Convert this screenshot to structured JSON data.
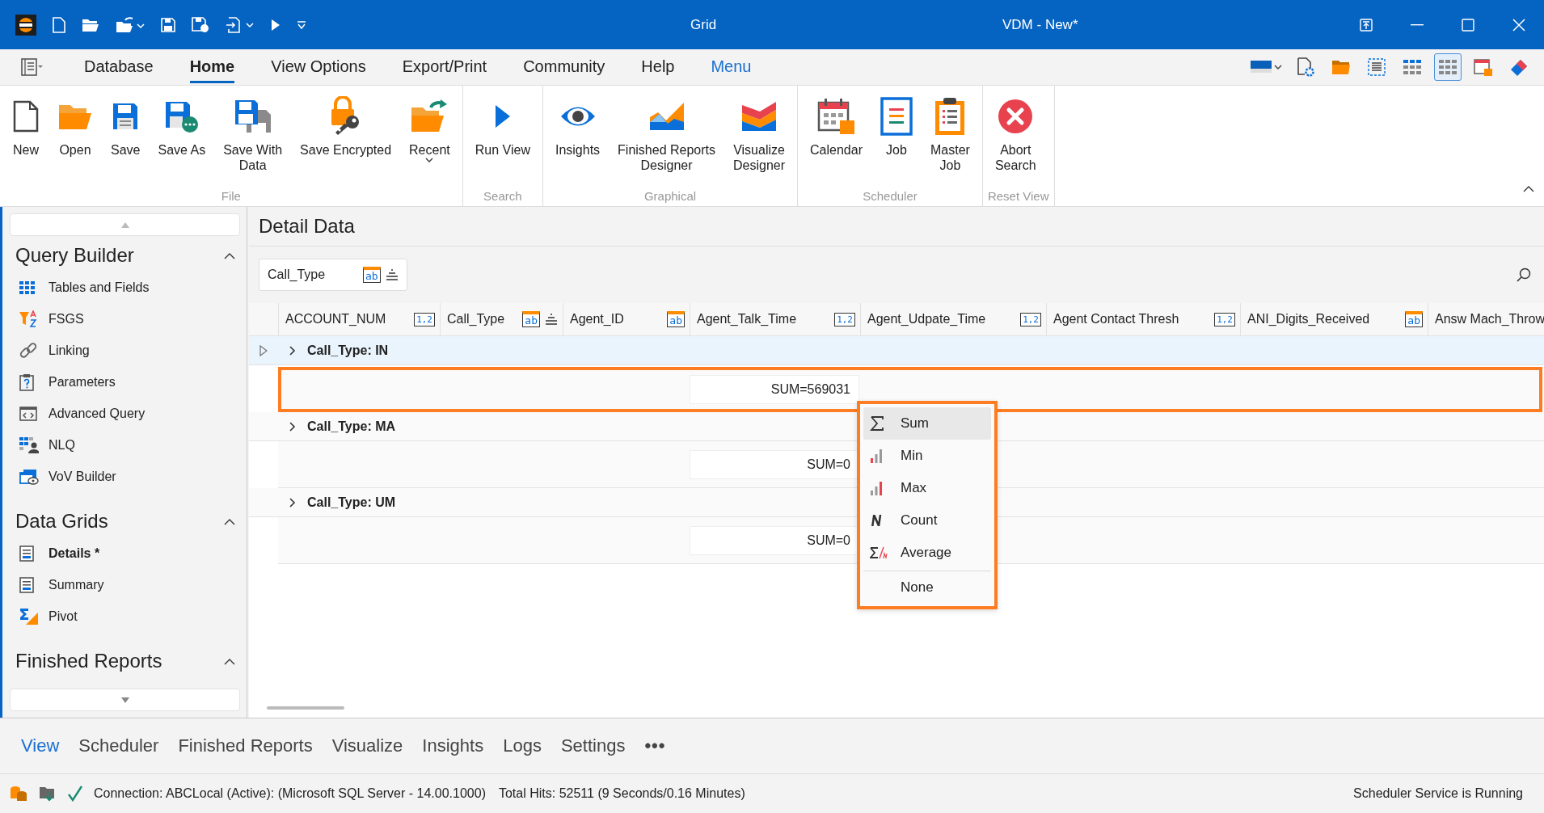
{
  "title_bar": {
    "app_name": "Grid",
    "title": "VDM - New*"
  },
  "menu_tabs": [
    {
      "label": "Database",
      "selected": false,
      "kind": "tab"
    },
    {
      "label": "Home",
      "selected": true,
      "kind": "tab"
    },
    {
      "label": "View Options",
      "selected": false,
      "kind": "tab"
    },
    {
      "label": "Export/Print",
      "selected": false,
      "kind": "tab"
    },
    {
      "label": "Community",
      "selected": false,
      "kind": "tab"
    },
    {
      "label": "Help",
      "selected": false,
      "kind": "tab"
    },
    {
      "label": "Menu",
      "selected": false,
      "kind": "link"
    }
  ],
  "layout_buttons": [
    {
      "selected": false
    },
    {
      "selected": false
    },
    {
      "selected": true
    }
  ],
  "ribbon": {
    "collapse_visible": true,
    "groups": [
      {
        "label": "File",
        "buttons": [
          {
            "label": "New",
            "dropdown": false
          },
          {
            "label": "Open",
            "dropdown": false
          },
          {
            "label": "Save",
            "dropdown": false
          },
          {
            "label": "Save As",
            "dropdown": false
          },
          {
            "label": "Save With\nData",
            "dropdown": false
          },
          {
            "label": "Save Encrypted",
            "dropdown": false
          },
          {
            "label": "Recent",
            "dropdown": true
          }
        ]
      },
      {
        "label": "Search",
        "buttons": [
          {
            "label": "Run View",
            "dropdown": false
          }
        ]
      },
      {
        "label": "Graphical",
        "buttons": [
          {
            "label": "Insights",
            "dropdown": false
          },
          {
            "label": "Finished Reports\nDesigner",
            "dropdown": false
          },
          {
            "label": "Visualize\nDesigner",
            "dropdown": false
          }
        ]
      },
      {
        "label": "Scheduler",
        "buttons": [
          {
            "label": "Calendar",
            "dropdown": false
          },
          {
            "label": "Job",
            "dropdown": false
          },
          {
            "label": "Master\nJob",
            "dropdown": false
          }
        ]
      },
      {
        "label": "Reset View",
        "buttons": [
          {
            "label": "Abort\nSearch",
            "dropdown": false
          }
        ]
      }
    ]
  },
  "sidebar": {
    "sections": [
      {
        "title": "Query Builder",
        "expanded": true,
        "items": [
          {
            "label": "Tables and Fields",
            "selected": false
          },
          {
            "label": "FSGS",
            "selected": false
          },
          {
            "label": "Linking",
            "selected": false
          },
          {
            "label": "Parameters",
            "selected": false
          },
          {
            "label": "Advanced Query",
            "selected": false
          },
          {
            "label": "NLQ",
            "selected": false
          },
          {
            "label": "VoV Builder",
            "selected": false
          }
        ]
      },
      {
        "title": "Data Grids",
        "expanded": true,
        "items": [
          {
            "label": "Details *",
            "selected": true
          },
          {
            "label": "Summary",
            "selected": false
          },
          {
            "label": "Pivot",
            "selected": false
          }
        ]
      },
      {
        "title": "Finished Reports",
        "expanded": true
      }
    ]
  },
  "detail": {
    "title": "Detail Data",
    "group_by": {
      "label": "Call_Type",
      "badge": "ab",
      "kind": "text",
      "sorted": true
    },
    "columns": [
      {
        "label": "ACCOUNT_NUM",
        "badge": "1,2",
        "kind": "number",
        "sorted": false
      },
      {
        "label": "Call_Type",
        "badge": "ab",
        "kind": "text",
        "sorted": true
      },
      {
        "label": "Agent_ID",
        "badge": "ab",
        "kind": "text",
        "sorted": false
      },
      {
        "label": "Agent_Talk_Time",
        "badge": "1,2",
        "kind": "number",
        "sorted": false
      },
      {
        "label": "Agent_Udpate_Time",
        "badge": "1,2",
        "kind": "number",
        "sorted": false
      },
      {
        "label": "Agent Contact Thresh",
        "badge": "1,2",
        "kind": "number",
        "sorted": false
      },
      {
        "label": "ANI_Digits_Received",
        "badge": "ab",
        "kind": "text",
        "sorted": false
      },
      {
        "label": "Answ Mach_Throw",
        "kind": "cut"
      }
    ],
    "groups": [
      {
        "label": "Call_Type: IN",
        "selected": true,
        "expanded": false,
        "summary": "SUM=569031",
        "highlighted": true
      },
      {
        "label": "Call_Type: MA",
        "selected": false,
        "expanded": false,
        "summary": "SUM=0",
        "highlighted": false
      },
      {
        "label": "Call_Type: UM",
        "selected": false,
        "expanded": false,
        "summary": "SUM=0",
        "highlighted": false
      }
    ],
    "summary_menu": {
      "highlighted": true,
      "items": [
        {
          "label": "Sum",
          "selected": true,
          "separator_before": false
        },
        {
          "label": "Min",
          "selected": false,
          "separator_before": false
        },
        {
          "label": "Max",
          "selected": false,
          "separator_before": false
        },
        {
          "label": "Count",
          "selected": false,
          "separator_before": false
        },
        {
          "label": "Average",
          "selected": false,
          "separator_before": false
        },
        {
          "label": "None",
          "selected": false,
          "separator_before": true
        }
      ]
    }
  },
  "bottom_tabs": {
    "items": [
      {
        "label": "View",
        "selected": true
      },
      {
        "label": "Scheduler",
        "selected": false
      },
      {
        "label": "Finished Reports",
        "selected": false
      },
      {
        "label": "Visualize",
        "selected": false
      },
      {
        "label": "Insights",
        "selected": false
      },
      {
        "label": "Logs",
        "selected": false
      },
      {
        "label": "Settings",
        "selected": false
      }
    ],
    "more": "•••"
  },
  "status_bar": {
    "connection": "Connection: ABCLocal (Active): (Microsoft SQL Server - 14.00.1000)",
    "total_hits": "Total Hits: 52511 (9 Seconds/0.16 Minutes)",
    "scheduler": "Scheduler Service is Running"
  }
}
